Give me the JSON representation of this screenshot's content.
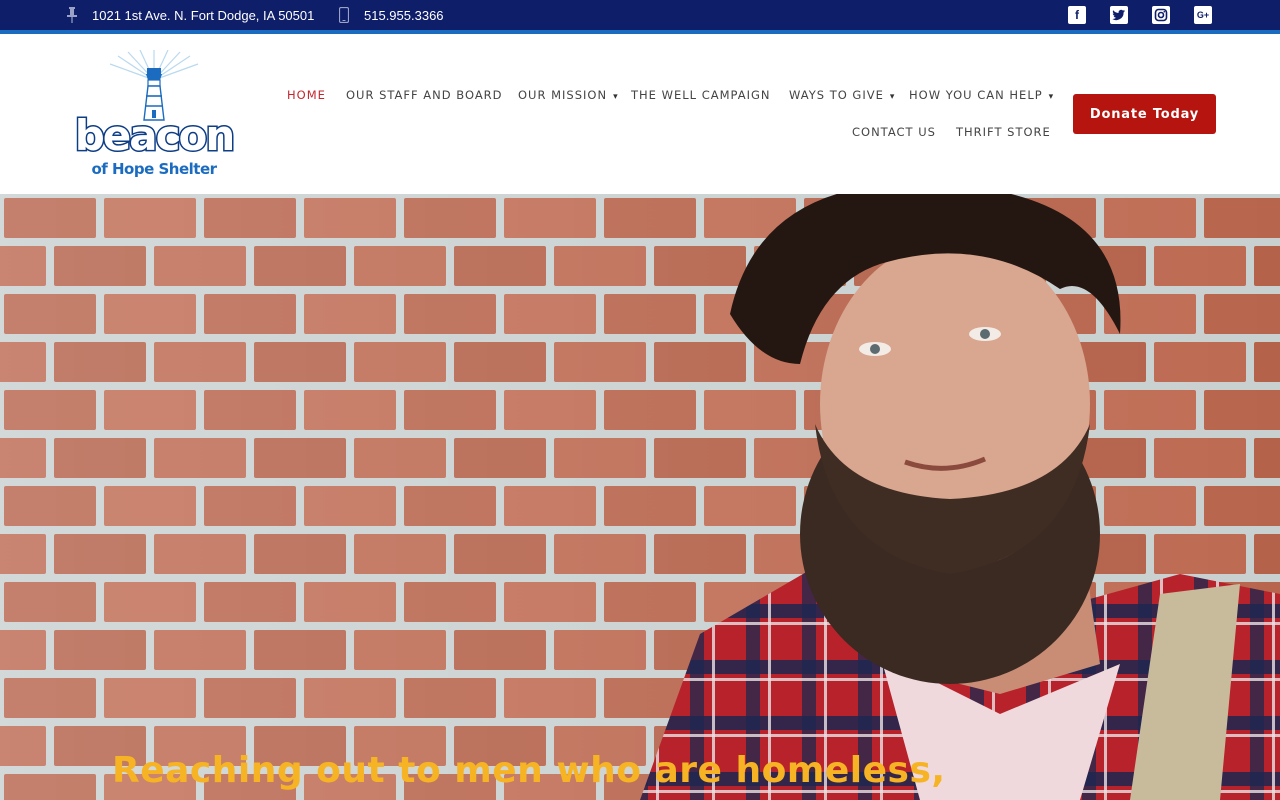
{
  "topbar": {
    "address": "1021 1st Ave. N. Fort Dodge, IA 50501",
    "phone": "515.955.3366",
    "social": [
      {
        "icon": "facebook-icon",
        "glyph": "f"
      },
      {
        "icon": "twitter-icon",
        "glyph": "t"
      },
      {
        "icon": "instagram-icon",
        "glyph": "◎"
      },
      {
        "icon": "google-plus-icon",
        "glyph": "G+"
      }
    ]
  },
  "logo": {
    "word": "beacon",
    "tagline": "of Hope Shelter"
  },
  "nav": {
    "home": "HOME",
    "staff": "OUR STAFF AND BOARD",
    "mission": "OUR MISSION",
    "well": "THE WELL CAMPAIGN",
    "give": "WAYS TO GIVE",
    "help": "HOW YOU CAN HELP",
    "contact": "CONTACT US",
    "thrift": "THRIFT STORE",
    "caret": "▾"
  },
  "donate_label": "Donate Today",
  "hero": {
    "headline": "Reaching out to men who are homeless,"
  },
  "colors": {
    "topbar": "#0f1e68",
    "accent": "#1b6cc0",
    "active_nav": "#c1272d",
    "donate": "#b5140f",
    "headline": "#f6b324"
  }
}
